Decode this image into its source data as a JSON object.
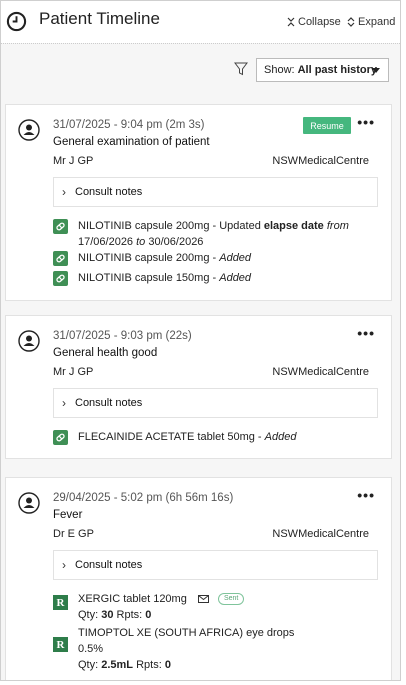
{
  "header": {
    "title": "Patient Timeline",
    "collapse_label": "Collapse",
    "expand_label": "Expand"
  },
  "toolbar": {
    "show_prefix": "Show:",
    "show_value": "All past history"
  },
  "colors": {
    "resume_button": "#45b77e",
    "med_icon": "#3f8f55",
    "rx_icon": "#2e7d4a"
  },
  "cards": [
    {
      "timestamp": "31/07/2025 - 9:04 pm (2m 3s)",
      "reason": "General examination of patient",
      "doctor": "Mr J GP",
      "clinic": "NSWMedicalCentre",
      "resume_label": "Resume",
      "consult_label": "Consult notes",
      "items": [
        {
          "icon": "medication-icon",
          "line1_main": "NILOTINIB capsule 200mg - Updated ",
          "line1_bold": "elapse date",
          "line1_italic": "from",
          "line2_a": "17/06/2026",
          "line2_italic": "to",
          "line2_b": "30/06/2026"
        },
        {
          "icon": "medication-icon",
          "name": "NILOTINIB capsule 200mg - ",
          "status": "Added"
        },
        {
          "icon": "medication-icon",
          "name": "NILOTINIB capsule 150mg - ",
          "status": "Added"
        }
      ]
    },
    {
      "timestamp": "31/07/2025 - 9:03 pm (22s)",
      "reason": "General health good",
      "doctor": "Mr J GP",
      "clinic": "NSWMedicalCentre",
      "consult_label": "Consult notes",
      "items": [
        {
          "icon": "medication-icon",
          "name": "FLECAINIDE ACETATE tablet 50mg - ",
          "status": "Added"
        }
      ]
    },
    {
      "timestamp": "29/04/2025 - 5:02 pm (6h 56m 16s)",
      "reason": "Fever",
      "doctor": "Dr E GP",
      "clinic": "NSWMedicalCentre",
      "consult_label": "Consult notes",
      "items": [
        {
          "icon": "prescription-icon",
          "name": "XERGIC tablet 120mg",
          "sent_label": "Sent",
          "qty_label": "Qty:",
          "qty": "30",
          "rpts_label": "Rpts:",
          "rpts": "0"
        },
        {
          "icon": "prescription-icon",
          "name_line1": "TIMOPTOL XE (SOUTH AFRICA) eye drops",
          "name_line2": "0.5%",
          "qty_label": "Qty:",
          "qty": "2.5mL",
          "rpts_label": "Rpts:",
          "rpts": "0"
        }
      ]
    }
  ]
}
